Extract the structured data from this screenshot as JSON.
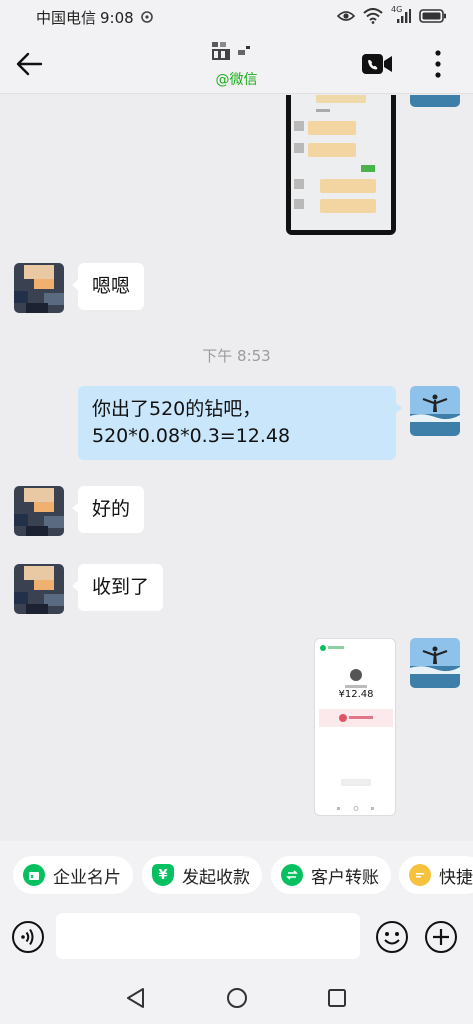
{
  "status_bar": {
    "carrier": "中国电信",
    "time": "9:08",
    "network": "4G"
  },
  "header": {
    "contact_subtitle": "@微信"
  },
  "chat": {
    "timestamp": "下午 8:53",
    "messages": [
      {
        "side": "left",
        "text": "嗯嗯"
      },
      {
        "side": "right",
        "text": "你出了520的钻吧，\n520*0.08*0.3=12.48"
      },
      {
        "side": "left",
        "text": "好的"
      },
      {
        "side": "left",
        "text": "收到了"
      }
    ],
    "payment_screenshot": {
      "amount": "¥12.48"
    }
  },
  "shortcuts": [
    {
      "label": "企业名片",
      "icon": "business-card-icon",
      "color": "#07c160"
    },
    {
      "label": "发起收款",
      "icon": "yuan-icon",
      "color": "#07c160"
    },
    {
      "label": "客户转账",
      "icon": "transfer-icon",
      "color": "#07c160"
    },
    {
      "label": "快捷",
      "icon": "quick-reply-icon",
      "color": "#f6c13c"
    }
  ],
  "input": {
    "placeholder": ""
  },
  "colors": {
    "accent": "#07c160",
    "bubble_right": "#c9e6fb",
    "background": "#ededf0"
  }
}
